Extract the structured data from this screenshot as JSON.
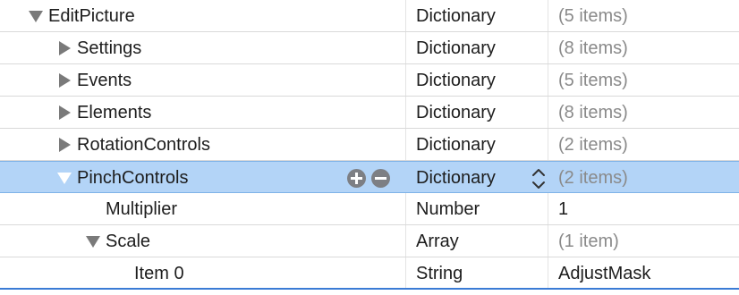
{
  "rows": [
    {
      "key": "EditPicture",
      "type": "Dictionary",
      "value": "(5 items)"
    },
    {
      "key": "Settings",
      "type": "Dictionary",
      "value": "(8 items)"
    },
    {
      "key": "Events",
      "type": "Dictionary",
      "value": "(5 items)"
    },
    {
      "key": "Elements",
      "type": "Dictionary",
      "value": "(8 items)"
    },
    {
      "key": "RotationControls",
      "type": "Dictionary",
      "value": "(2 items)"
    },
    {
      "key": "PinchControls",
      "type": "Dictionary",
      "value": "(2 items)"
    },
    {
      "key": "Multiplier",
      "type": "Number",
      "value": "1"
    },
    {
      "key": "Scale",
      "type": "Array",
      "value": "(1 item)"
    },
    {
      "key": "Item 0",
      "type": "String",
      "value": "AdjustMask"
    }
  ],
  "colors": {
    "selection": "#b3d4f7",
    "muted_value": "#8a8a8a",
    "disclosure": "#7a7a7a",
    "circle_button": "#7d7f84"
  },
  "icons": {
    "add": "plus-circle-icon",
    "remove": "minus-circle-icon",
    "type_stepper": "up-down-chevron-icon"
  }
}
